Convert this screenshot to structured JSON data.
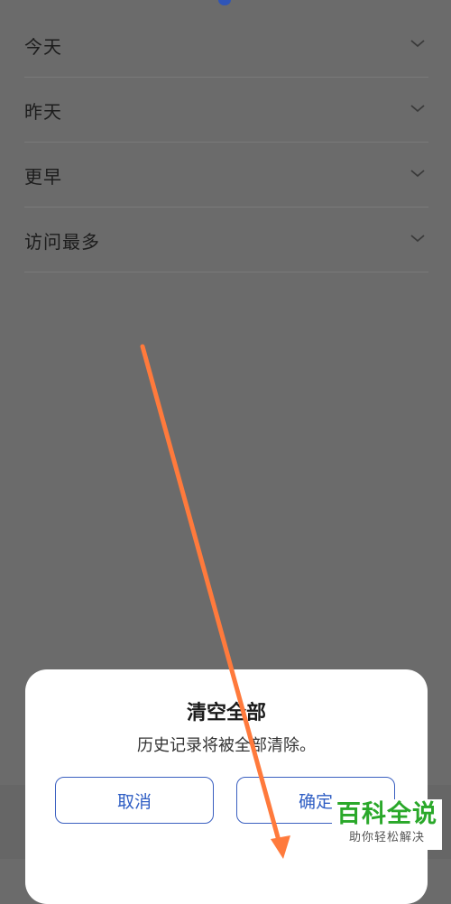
{
  "history_list": {
    "items": [
      {
        "label": "今天"
      },
      {
        "label": "昨天"
      },
      {
        "label": "更早"
      },
      {
        "label": "访问最多"
      }
    ]
  },
  "dialog": {
    "title": "清空全部",
    "message": "历史记录将被全部清除。",
    "cancel_label": "取消",
    "confirm_label": "确定"
  },
  "overlay": {
    "arrow_color": "#ff7a3c"
  },
  "watermark": {
    "main": "百科全说",
    "sub": "助你轻松解决"
  },
  "colors": {
    "accent": "#2f5ec4",
    "backdrop": "#6b6b6b",
    "watermark_green": "#2aa82a"
  }
}
